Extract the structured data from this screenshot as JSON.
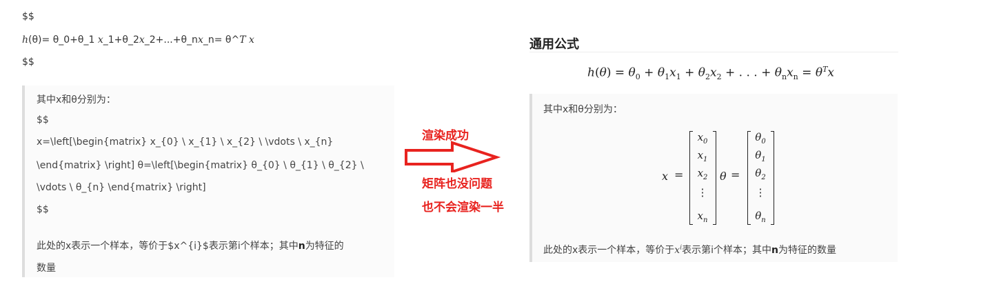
{
  "raw": {
    "line1": "$$",
    "h_var": "h",
    "line2_rest": "(θ)= θ_0+θ_1 ",
    "x1": "x",
    "seg1": "_1+θ_2",
    "x2": "x",
    "seg2": "_2+...+θ_n",
    "xn": "x",
    "seg3": "_n= θ^",
    "T": "T",
    "sp": " ",
    "xend": "x",
    "line3": "$$",
    "quote": {
      "intro": "其中x和θ分别为：",
      "d1": "$$",
      "l1": "x=\\left[\\begin{matrix}   x_{0}   \\   x_{1}   \\   x_{2}   \\   \\vdots   \\   x_{n}",
      "l2": "\\end{matrix}  \\right]  θ=\\left[\\begin{matrix}  θ_{0}  \\  θ_{1}  \\  θ_{2}  \\",
      "l3": "\\vdots \\ θ_{n} \\end{matrix} \\right]",
      "d2": "$$",
      "desc_a": "此处的x表示一个样本，等价于$x^{i}$表示第i个样本；其中",
      "desc_n": "n",
      "desc_b": "为特征的",
      "desc_c": "数量"
    }
  },
  "annotation": {
    "top": "渲染成功",
    "mid": "矩阵也没问题",
    "bottom": "也不会渲染一半",
    "color": "#e8231f"
  },
  "rendered": {
    "title": "通用公式",
    "formula": {
      "h": "h",
      "open": "(",
      "theta": "θ",
      "close": ") = ",
      "t0": "θ",
      "s0": "0",
      "plus1": " + ",
      "t1": "θ",
      "s1": "1",
      "x1": "x",
      "sx1": "1",
      "plus2": " + ",
      "t2": "θ",
      "s2": "2",
      "x2": "x",
      "sx2": "2",
      "dots": " + . . . + ",
      "tn": "θ",
      "sn": "n",
      "xn": "x",
      "sxn": "n",
      "eq": " = ",
      "tT": "θ",
      "T": "T",
      "xT": "x"
    },
    "intro": "其中x和θ分别为：",
    "matrix": {
      "x_label": "x",
      "eq1": "=",
      "x_entries": [
        {
          "base": "x",
          "sub": "0"
        },
        {
          "base": "x",
          "sub": "1"
        },
        {
          "base": "x",
          "sub": "2"
        },
        {
          "base": "⋮",
          "sub": ""
        },
        {
          "base": "x",
          "sub": "n"
        }
      ],
      "theta_label": "θ",
      "eq2": "=",
      "theta_entries": [
        {
          "base": "θ",
          "sub": "0"
        },
        {
          "base": "θ",
          "sub": "1"
        },
        {
          "base": "θ",
          "sub": "2"
        },
        {
          "base": "⋮",
          "sub": ""
        },
        {
          "base": "θ",
          "sub": "n"
        }
      ]
    },
    "desc_a": "此处的x表示一个样本，等价于",
    "desc_x": "x",
    "desc_i": "i",
    "desc_b": "表示第i个样本；其中",
    "desc_n": "n",
    "desc_c": "为特征的数量"
  }
}
